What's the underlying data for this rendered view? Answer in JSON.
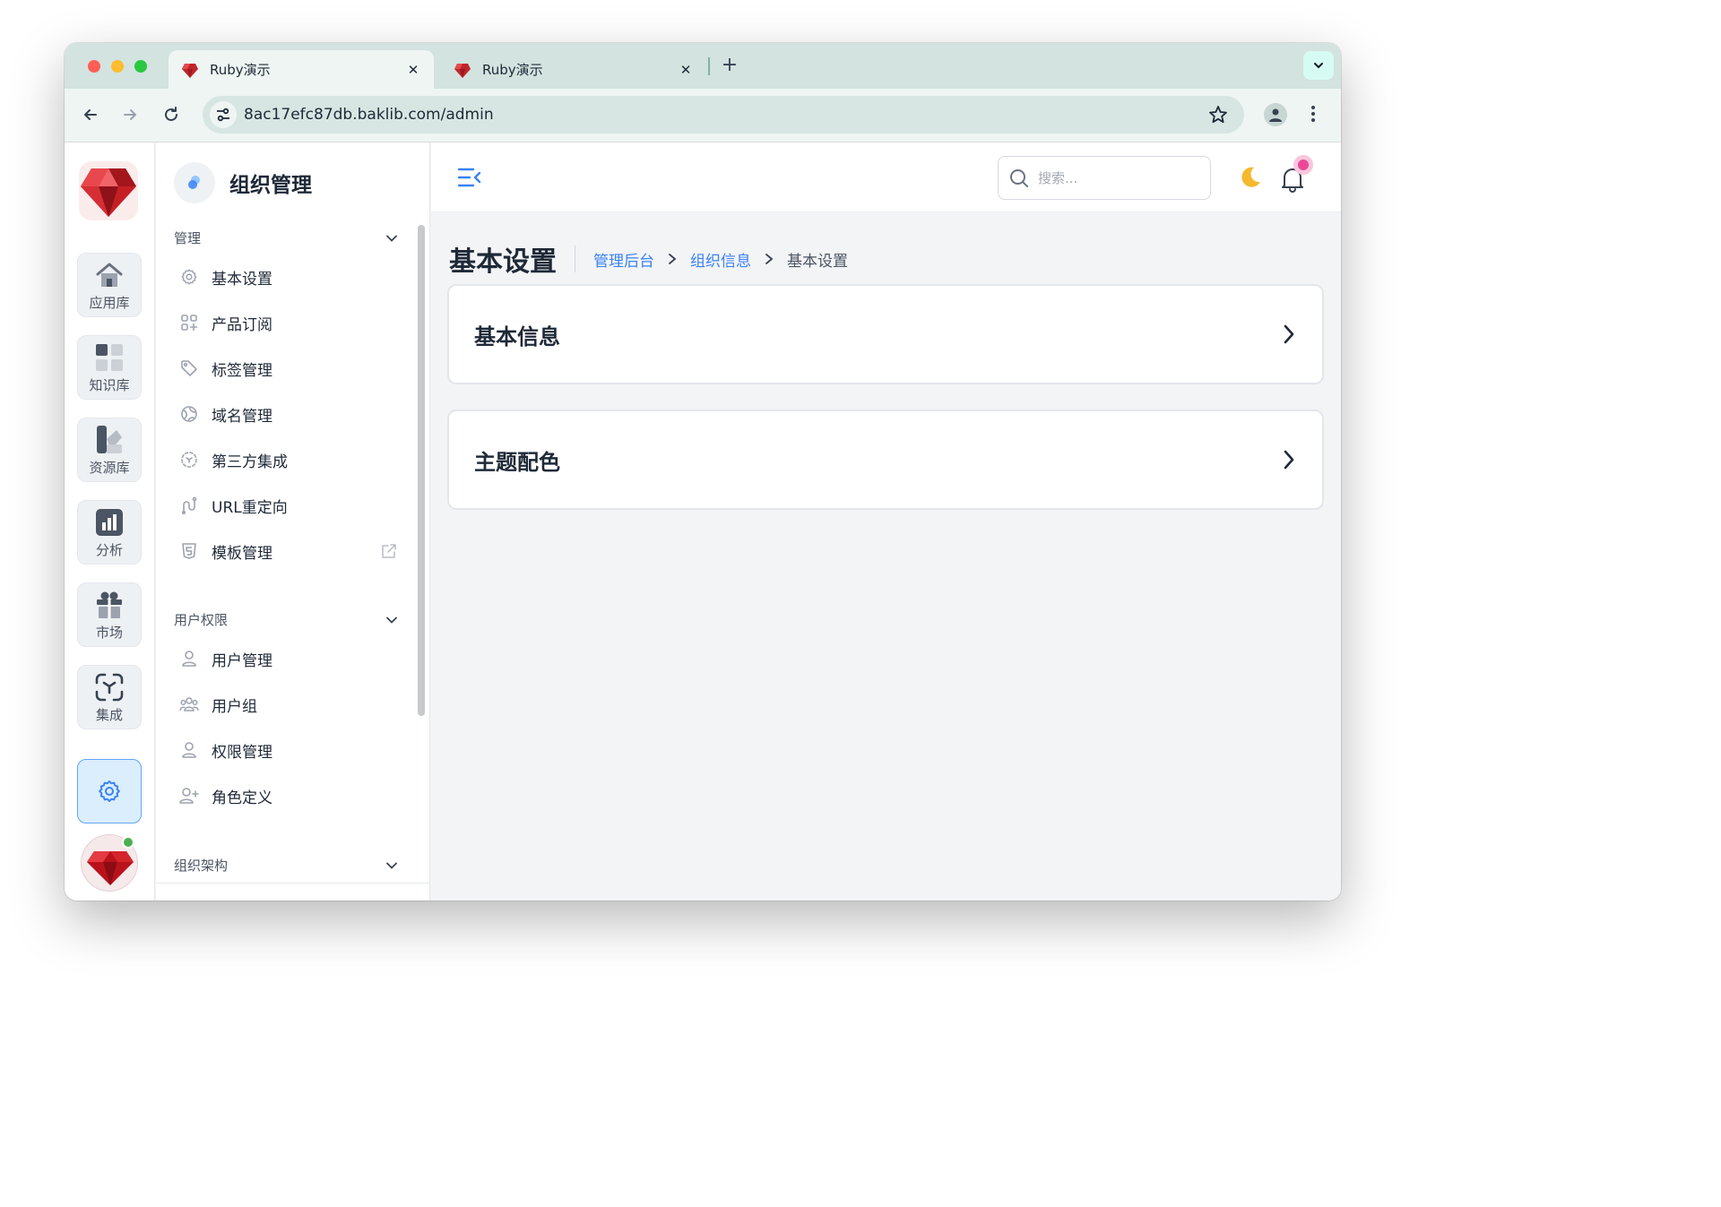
{
  "browser": {
    "tabs": [
      {
        "title": "Ruby演示",
        "active": true
      },
      {
        "title": "Ruby演示",
        "active": false
      }
    ],
    "url": "8ac17efc87db.baklib.com/admin"
  },
  "rail": {
    "items": [
      {
        "label": "应用库",
        "icon": "home-icon"
      },
      {
        "label": "知识库",
        "icon": "grid-icon"
      },
      {
        "label": "资源库",
        "icon": "asset-icon"
      },
      {
        "label": "分析",
        "icon": "bar-chart-icon"
      },
      {
        "label": "市场",
        "icon": "gift-icon"
      },
      {
        "label": "集成",
        "icon": "integration-icon"
      }
    ],
    "settings_icon": "gear-icon"
  },
  "sidebar": {
    "title": "组织管理",
    "sections": [
      {
        "label": "管理",
        "items": [
          {
            "label": "基本设置",
            "icon": "gear-icon"
          },
          {
            "label": "产品订阅",
            "icon": "apps-icon"
          },
          {
            "label": "标签管理",
            "icon": "tag-icon"
          },
          {
            "label": "域名管理",
            "icon": "globe-icon"
          },
          {
            "label": "第三方集成",
            "icon": "integration-icon"
          },
          {
            "label": "URL重定向",
            "icon": "redirect-icon"
          },
          {
            "label": "模板管理",
            "icon": "html5-icon",
            "external": true
          }
        ]
      },
      {
        "label": "用户权限",
        "items": [
          {
            "label": "用户管理",
            "icon": "user-icon"
          },
          {
            "label": "用户组",
            "icon": "users-icon"
          },
          {
            "label": "权限管理",
            "icon": "user-icon"
          },
          {
            "label": "角色定义",
            "icon": "user-plus-icon"
          }
        ]
      },
      {
        "label": "组织架构",
        "items": []
      }
    ]
  },
  "topbar": {
    "search_placeholder": "搜索..."
  },
  "page": {
    "title": "基本设置",
    "breadcrumb": [
      {
        "label": "管理后台",
        "link": true
      },
      {
        "label": "组织信息",
        "link": true
      },
      {
        "label": "基本设置",
        "link": false
      }
    ],
    "cards": [
      {
        "title": "基本信息"
      },
      {
        "title": "主题配色"
      }
    ]
  },
  "colors": {
    "accent": "#3b82f6",
    "notification": "#ec4899",
    "moon": "#f5b82e",
    "online": "#4caf50"
  }
}
